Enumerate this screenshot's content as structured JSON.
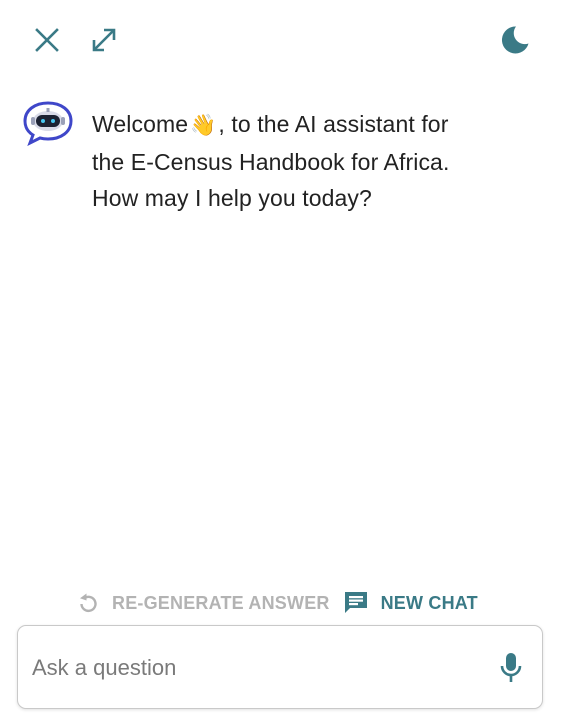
{
  "header": {
    "close_icon": "close-icon",
    "expand_icon": "expand-icon",
    "theme_icon": "moon-icon"
  },
  "message": {
    "avatar_icon": "chatbot-avatar-icon",
    "line1_prefix": "Welcome",
    "wave_emoji": "👋",
    "line1_suffix": ", to the AI assistant for",
    "line2": "the E-Census Handbook for Africa.",
    "line3": "How may I help you today?"
  },
  "actions": {
    "regenerate_label": "RE-GENERATE ANSWER",
    "regenerate_icon": "refresh-icon",
    "new_chat_label": "NEW CHAT",
    "new_chat_icon": "chat-icon"
  },
  "input": {
    "placeholder": "Ask a question",
    "value": "",
    "mic_icon": "microphone-icon"
  },
  "colors": {
    "accent": "#3a7a86",
    "disabled": "#b3b3b3",
    "text": "#222222"
  }
}
